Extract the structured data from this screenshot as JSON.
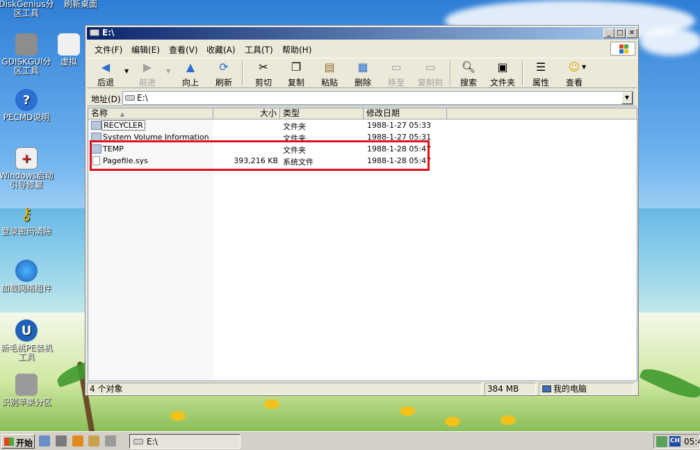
{
  "desktop": {
    "icons": [
      {
        "label": "DiskGenius分区工具"
      },
      {
        "label": "刷新桌面"
      },
      {
        "label": "GDISKGUI分区工具"
      },
      {
        "label": "虚拟"
      },
      {
        "label": "PECMD说明"
      },
      {
        "label": "Windows启动引导修复"
      },
      {
        "label": "登录密码清除"
      },
      {
        "label": "加载网络组件"
      },
      {
        "label": "新毛桃PE装机工具"
      },
      {
        "label": "识别苹果分区"
      }
    ]
  },
  "window": {
    "title": "E:\\",
    "menu": [
      "文件(F)",
      "编辑(E)",
      "查看(V)",
      "收藏(A)",
      "工具(T)",
      "帮助(H)"
    ],
    "toolbar": [
      {
        "label": "后退",
        "icon": "back-arrow-icon"
      },
      {
        "label": "前进",
        "icon": "forward-arrow-icon",
        "disabled": true
      },
      {
        "label": "向上",
        "icon": "up-arrow-icon"
      },
      {
        "label": "刷新",
        "icon": "refresh-icon"
      },
      {
        "label": "剪切",
        "icon": "scissors-icon"
      },
      {
        "label": "复制",
        "icon": "copy-icon"
      },
      {
        "label": "粘贴",
        "icon": "paste-icon"
      },
      {
        "label": "删除",
        "icon": "delete-icon"
      },
      {
        "label": "移至",
        "icon": "move-to-icon",
        "disabled": true
      },
      {
        "label": "复制到",
        "icon": "copy-to-icon",
        "disabled": true
      },
      {
        "label": "搜索",
        "icon": "search-icon"
      },
      {
        "label": "文件夹",
        "icon": "folders-icon"
      },
      {
        "label": "属性",
        "icon": "properties-icon"
      },
      {
        "label": "查看",
        "icon": "views-icon"
      }
    ],
    "address": {
      "label": "地址(D)",
      "value": "E:\\"
    },
    "columns": {
      "name": "名称",
      "size": "大小",
      "type": "类型",
      "date": "修改日期"
    },
    "files": [
      {
        "name": "RECYCLER",
        "size": "",
        "type": "文件夹",
        "date": "1988-1-27 05:33",
        "kind": "folder"
      },
      {
        "name": "System Volume Information",
        "size": "",
        "type": "文件夹",
        "date": "1988-1-27 05:31",
        "kind": "folder"
      },
      {
        "name": "TEMP",
        "size": "",
        "type": "文件夹",
        "date": "1988-1-28 05:47",
        "kind": "folder"
      },
      {
        "name": "Pagefile.sys",
        "size": "393,216 KB",
        "type": "系统文件",
        "date": "1988-1-28 05:47",
        "kind": "file"
      }
    ],
    "status": {
      "count": "4 个对象",
      "size": "384 MB",
      "location": "我的电脑"
    }
  },
  "taskbar": {
    "start": "开始",
    "task": "E:\\",
    "lang": "CH",
    "time": "05:4"
  },
  "colors": {
    "highlight": "#e0101c",
    "title_start": "#0a246a",
    "title_end": "#a6caf0"
  }
}
